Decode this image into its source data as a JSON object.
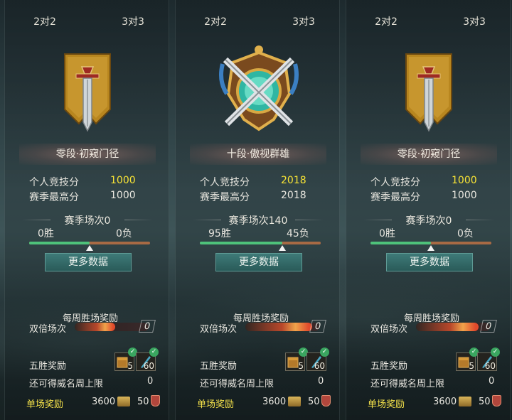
{
  "panels": [
    {
      "tabs": [
        "2对2",
        "3对3"
      ],
      "rank": "零段·初窥门径",
      "emblem": "banner-sword-icon",
      "stats": [
        {
          "label": "个人竞技分",
          "value": "1000",
          "highlight": true
        },
        {
          "label": "赛季最高分",
          "value": "1000",
          "highlight": false
        }
      ],
      "season_matches": "赛季场次0",
      "wins": "0胜",
      "losses": "0负",
      "win_ratio": 0.5,
      "more_button": "更多数据",
      "weekly_title": "每周胜场奖励",
      "double_label": "双倍场次",
      "double_count": "0",
      "double_fill": 0.55,
      "five_win_label": "五胜奖励",
      "reward_counts": [
        "5",
        "60"
      ],
      "limit_label": "还可得威名周上限",
      "limit_value": "0",
      "single_label": "单场奖励",
      "coins": "3600",
      "tokens": "50"
    },
    {
      "tabs": [
        "2对2",
        "3对3"
      ],
      "rank": "十段·傲视群雄",
      "emblem": "crossed-swords-shield-icon",
      "stats": [
        {
          "label": "个人竞技分",
          "value": "2018",
          "highlight": true
        },
        {
          "label": "赛季最高分",
          "value": "2018",
          "highlight": false
        }
      ],
      "season_matches": "赛季场次140",
      "wins": "95胜",
      "losses": "45负",
      "win_ratio": 0.68,
      "more_button": "更多数据",
      "weekly_title": "每周胜场奖励",
      "double_label": "双倍场次",
      "double_count": "0",
      "double_fill": 0.9,
      "five_win_label": "五胜奖励",
      "reward_counts": [
        "5",
        "60"
      ],
      "limit_label": "还可得威名周上限",
      "limit_value": "0",
      "single_label": "单场奖励",
      "coins": "3600",
      "tokens": "50"
    },
    {
      "tabs": [
        "2对2",
        "3对3"
      ],
      "rank": "零段·初窥门径",
      "emblem": "banner-sword-icon",
      "stats": [
        {
          "label": "个人竞技分",
          "value": "1000",
          "highlight": true
        },
        {
          "label": "赛季最高分",
          "value": "1000",
          "highlight": false
        }
      ],
      "season_matches": "赛季场次0",
      "wins": "0胜",
      "losses": "0负",
      "win_ratio": 0.5,
      "more_button": "更多数据",
      "weekly_title": "每周胜场奖励",
      "double_label": "双倍场次",
      "double_count": "0",
      "double_fill": 0.85,
      "five_win_label": "五胜奖励",
      "reward_counts": [
        "5",
        "60"
      ],
      "limit_label": "还可得威名周上限",
      "limit_value": "0",
      "single_label": "单场奖励",
      "coins": "3600",
      "tokens": "50"
    }
  ],
  "colors": {
    "highlight": "#f7e335",
    "win_bar": "#4ec27a",
    "loss_bar": "#a86a44",
    "button": "#2a5b59"
  }
}
